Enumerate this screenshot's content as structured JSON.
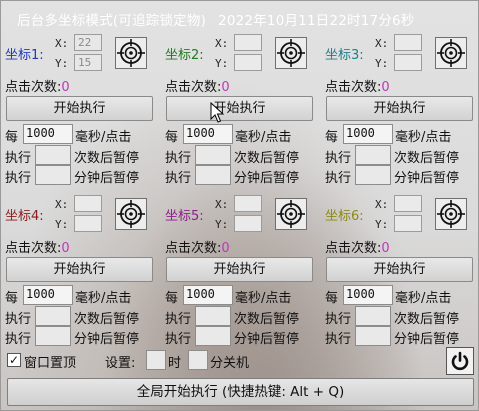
{
  "window": {
    "title": "后台多坐标模式(可追踪锁定物)",
    "datetime": "2022年10月11日22时17分6秒"
  },
  "labels": {
    "x": "X:",
    "y": "Y:",
    "click_count": "点击次数:",
    "start": "开始执行",
    "every": "每",
    "ms_per_click": "毫秒/点击",
    "execute": "执行",
    "pause_after_times": "次数后暂停",
    "pause_after_minutes": "分钟后暂停"
  },
  "slots": [
    {
      "title": "坐标1:",
      "color": "#1f39b8",
      "x": "22",
      "y": "15",
      "count": "0",
      "interval": "1000",
      "times": "",
      "minutes": ""
    },
    {
      "title": "坐标2:",
      "color": "#1f7a1f",
      "x": "",
      "y": "",
      "count": "0",
      "interval": "1000",
      "times": "",
      "minutes": ""
    },
    {
      "title": "坐标3:",
      "color": "#1b7f8a",
      "x": "",
      "y": "",
      "count": "0",
      "interval": "1000",
      "times": "",
      "minutes": ""
    },
    {
      "title": "坐标4:",
      "color": "#8a1c1c",
      "x": "",
      "y": "",
      "count": "0",
      "interval": "1000",
      "times": "",
      "minutes": ""
    },
    {
      "title": "坐标5:",
      "color": "#8a1f8a",
      "x": "",
      "y": "",
      "count": "0",
      "interval": "1000",
      "times": "",
      "minutes": ""
    },
    {
      "title": "坐标6:",
      "color": "#8a8a16",
      "x": "",
      "y": "",
      "count": "0",
      "interval": "1000",
      "times": "",
      "minutes": ""
    }
  ],
  "bottom": {
    "topmost_label": "窗口置顶",
    "topmost_checked": "✓",
    "settings_label": "设置:",
    "hour_label": "时",
    "minute_shutdown_label": "分关机",
    "global_start": "全局开始执行 (快捷热键: Alt + Q)"
  },
  "icons": {
    "target": "crosshair-target-icon",
    "power": "power-icon"
  }
}
